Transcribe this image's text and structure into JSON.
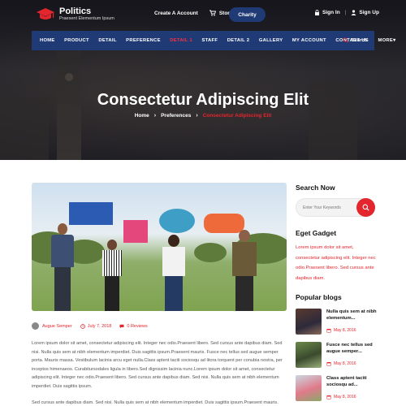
{
  "brand": {
    "title": "Politics",
    "subtitle": "Praesent Elementum Ipsum"
  },
  "topbar": {
    "create_account": "Create A Account",
    "store": "Store",
    "charity": "Charity",
    "sign_in": "Sign In",
    "sign_up": "Sign Up"
  },
  "nav": {
    "items": [
      "HOME",
      "PRODUCT",
      "DETAIL",
      "PREFERENCE",
      "DETAIL 1",
      "STAFF",
      "DETAIL 2",
      "GALLERY",
      "MY ACCOUNT",
      "CONTACT US",
      "MORE"
    ],
    "active_index": 4,
    "search": "Search"
  },
  "hero": {
    "title": "Consectetur Adipiscing Elit",
    "breadcrumb": [
      "Home",
      "Preferences",
      "Consectetur Adipiscing Elit"
    ]
  },
  "post": {
    "author": "Augue Semper",
    "date": "July 7, 2018",
    "reviews": "0 Reviews",
    "paragraph1": "Lorem ipsum dolor sit amet, consectetur adipiscing elit. Integer nec odio.Praesent libero. Sed cursus ante dapibus diam. Sed nisi. Nulla quis sem at nibh elementum imperdiet. Duis sagittis ipsum.Praesent mauris. Fusce nec tellus sed augue semper porta. Mauris massa. Vestibulum lacinia arcu eget nulla.Class aptent taciti sociosqu ad litora torquent per conubia nostra, per inceptos himenaeos. Curabitursodales ligula in libero.Sed dignissim lacinia nunc.Lorem ipsum dolor sit amet, consectetur adipiscing elit. Integer nec odio.Praesent libero. Sed cursus ante dapibus diam. Sed nisi. Nulla quis sem at nibh elementum imperdiet. Duis sagittis ipsum.",
    "paragraph2": "Sed cursus ante dapibus diam. Sed nisi. Nulla quis sem at nibh elementum imperdiet. Duis sagittis ipsum.Praesent mauris."
  },
  "sidebar": {
    "search_heading": "Search Now",
    "search_placeholder": "Enter Your Keywords",
    "gadget_heading": "Eget Gadget",
    "gadget_text": "Lorem ipsum dolor sit amet, consectetur adipiscing elit. Integer nec odio.Praesent libero. Sed cursus ante dapibus diam.",
    "blogs_heading": "Popular blogs",
    "blogs": [
      {
        "title": "Nulla quis sem at nibh elementum...",
        "date": "May 8, 2016"
      },
      {
        "title": "Fusce nec tellus sed augue semper...",
        "date": "May 8, 2016"
      },
      {
        "title": "Class aptent taciti sociosqu ad...",
        "date": "May 8, 2016"
      }
    ]
  },
  "colors": {
    "brand_blue": "#1f3a74",
    "accent_red": "#e3252d"
  }
}
